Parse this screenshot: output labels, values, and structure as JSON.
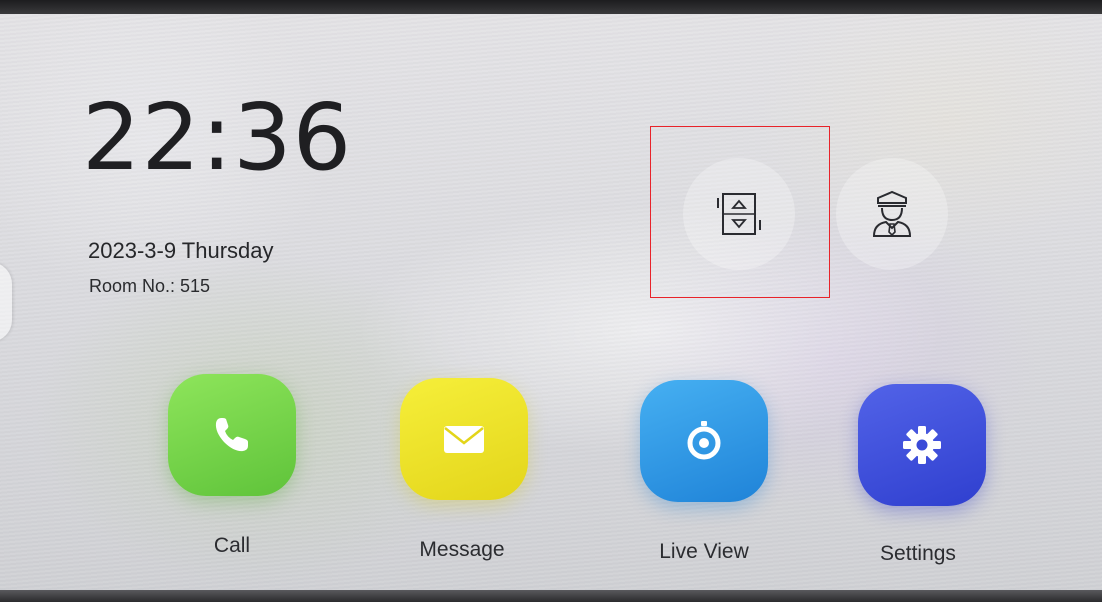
{
  "status": {
    "time": "22:36",
    "date": "2023-3-9",
    "weekday": "Thursday",
    "room": "Room No.: 515"
  },
  "quick_actions": [
    {
      "name": "elevator",
      "icon": "elevator-icon"
    },
    {
      "name": "guard",
      "icon": "security-guard-icon"
    }
  ],
  "apps": [
    {
      "label": "Call",
      "icon": "phone-icon",
      "color": "#6fd245"
    },
    {
      "label": "Message",
      "icon": "envelope-icon",
      "color": "#efe22a"
    },
    {
      "label": "Live View",
      "icon": "camera-icon",
      "color": "#2f9ae6"
    },
    {
      "label": "Settings",
      "icon": "gear-icon",
      "color": "#3f50dc"
    }
  ],
  "colors": {
    "highlight": "#e8232a",
    "text": "#1f1f22"
  }
}
